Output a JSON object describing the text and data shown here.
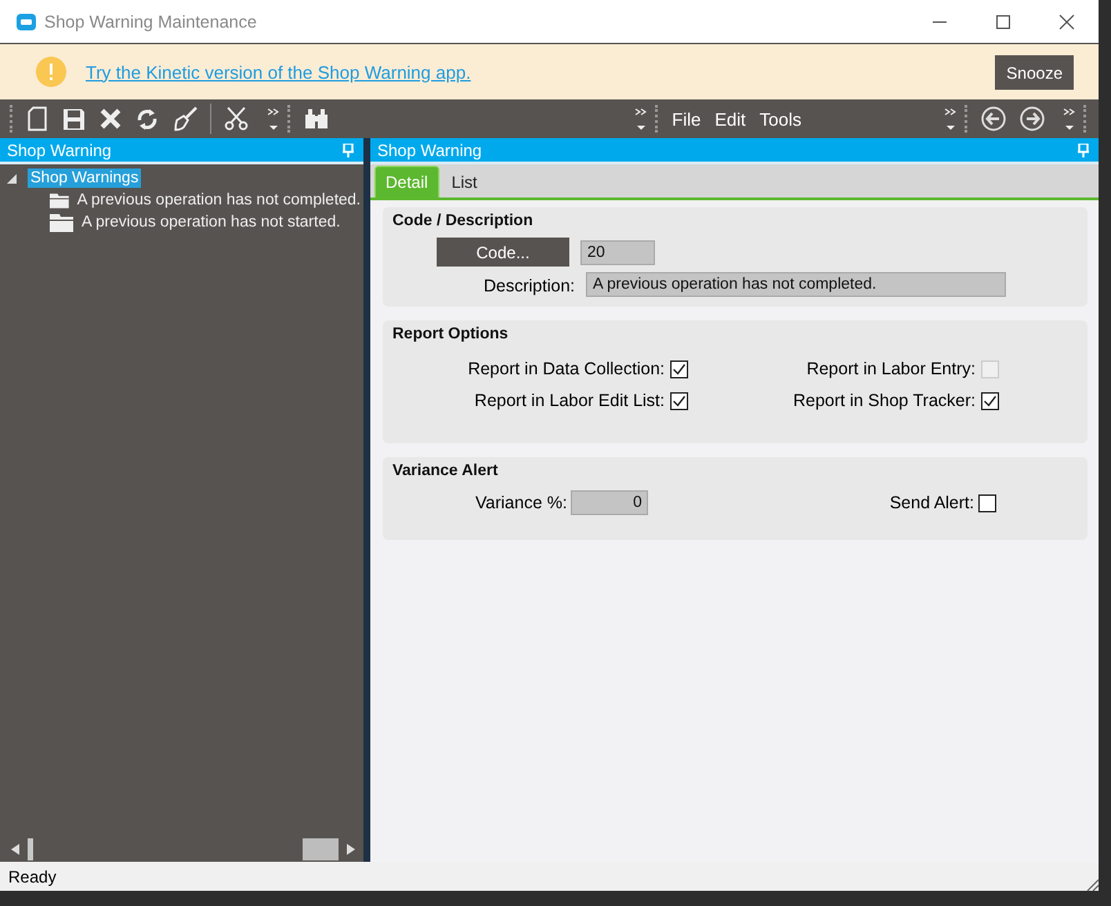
{
  "window": {
    "title": "Shop Warning Maintenance"
  },
  "banner": {
    "link": "Try the Kinetic version of the Shop Warning app.",
    "button": "Snooze"
  },
  "menu": [
    "File",
    "Edit",
    "Tools"
  ],
  "tree": {
    "title": "Shop Warning",
    "items": [
      {
        "label": "Shop Warnings",
        "selected": true,
        "expanded": true,
        "children": [
          {
            "label": "A previous operation has not completed.",
            "selected": false
          },
          {
            "label": "A previous operation has not started.",
            "selected": false
          }
        ]
      }
    ]
  },
  "detail": {
    "title": "Shop Warning",
    "tabs": [
      {
        "label": "Detail",
        "selected": true
      },
      {
        "label": "List",
        "selected": false
      }
    ],
    "code_group": {
      "title": "Code / Description",
      "code_button": "Code...",
      "code": "20",
      "description_label": "Description:",
      "description": "A previous operation has not completed."
    },
    "report_group": {
      "title": "Report Options",
      "options": [
        {
          "label": "Report in Data Collection:",
          "checked": true,
          "disabled": false
        },
        {
          "label": "Report in Labor Entry:",
          "checked": false,
          "disabled": true
        },
        {
          "label": "Report in Labor Edit List:",
          "checked": true,
          "disabled": false
        },
        {
          "label": "Report in Shop Tracker:",
          "checked": true,
          "disabled": false
        }
      ]
    },
    "variance_group": {
      "title": "Variance Alert",
      "variance_label": "Variance %:",
      "variance": "0",
      "send_label": "Send Alert:",
      "send_checked": false
    }
  },
  "status_bar": "Ready"
}
